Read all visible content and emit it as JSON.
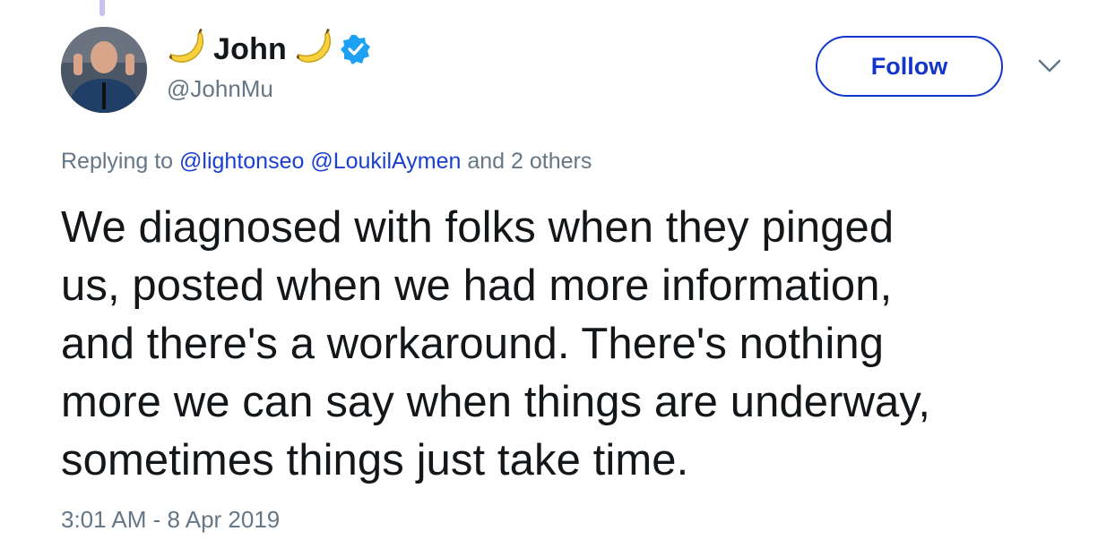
{
  "tweet": {
    "author": {
      "display_name": "John",
      "handle": "@JohnMu",
      "name_emoji": "banana-icon",
      "verified_icon": "verified-badge-icon"
    },
    "follow_button_label": "Follow",
    "menu_icon": "chevron-down-icon",
    "reply": {
      "prefix": "Replying to",
      "mentions": [
        "@lightonseo",
        "@LoukilAymen"
      ],
      "suffix": "and 2 others"
    },
    "text_lines": [
      "We diagnosed with folks when they pinged",
      "us, posted when we had more information,",
      "and there's a workaround. There's nothing",
      "more we can say when things are underway,",
      "sometimes things just take time."
    ],
    "timestamp": "3:01 AM - 8 Apr 2019"
  },
  "colors": {
    "accent": "#1335cc",
    "link": "#1b3fd1",
    "secondary_text": "#657786",
    "verified": "#1da1f2",
    "thread_line": "#c7c1f2"
  }
}
